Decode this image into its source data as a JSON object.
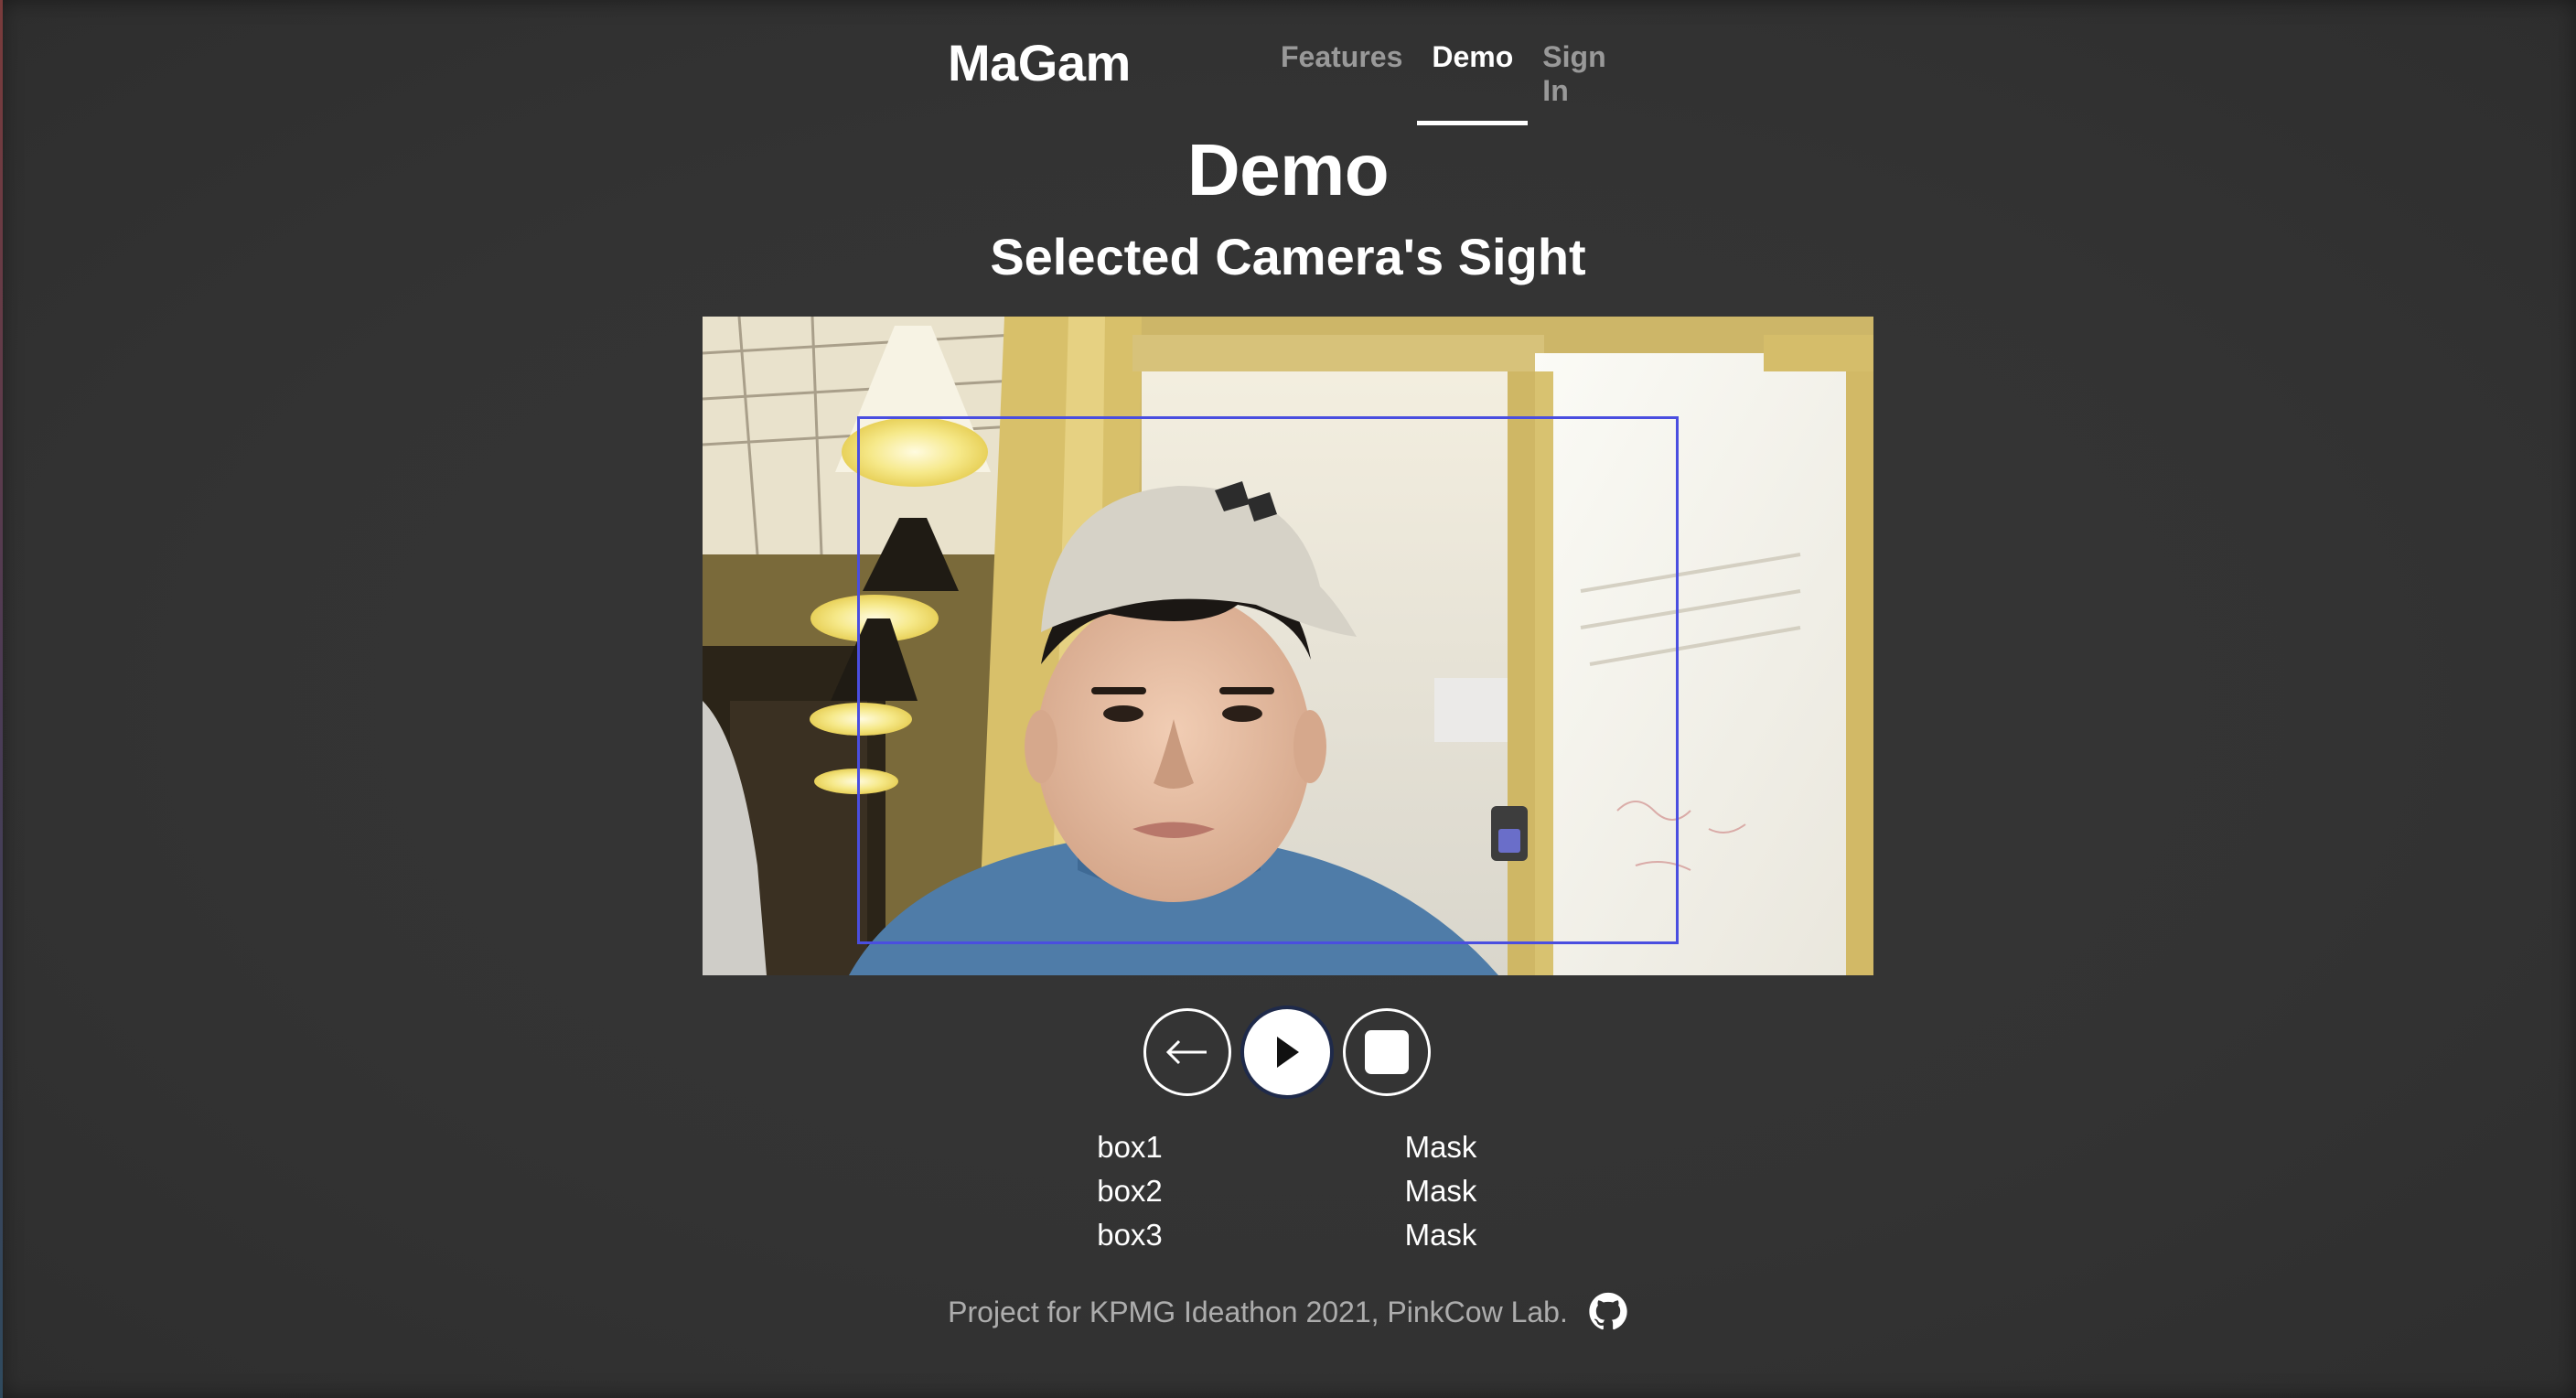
{
  "nav": {
    "brand": "MaGam",
    "links": [
      {
        "label": "Features",
        "active": false
      },
      {
        "label": "Demo",
        "active": true
      },
      {
        "label": "Sign In",
        "active": false
      }
    ]
  },
  "page": {
    "title": "Demo",
    "subtitle": "Selected Camera's Sight"
  },
  "camera": {
    "feed_icon": "camera-feed-image",
    "detection_box_color": "#4a4ee0"
  },
  "controls": [
    {
      "name": "back",
      "icon": "arrow-left-icon"
    },
    {
      "name": "play",
      "icon": "play-icon"
    },
    {
      "name": "stop",
      "icon": "stop-icon"
    }
  ],
  "boxes": [
    {
      "name": "box1",
      "value": "Mask"
    },
    {
      "name": "box2",
      "value": "Mask"
    },
    {
      "name": "box3",
      "value": "Mask"
    }
  ],
  "footer": {
    "text": "Project for KPMG Ideathon 2021, PinkCow Lab.",
    "icon": "github-icon"
  }
}
